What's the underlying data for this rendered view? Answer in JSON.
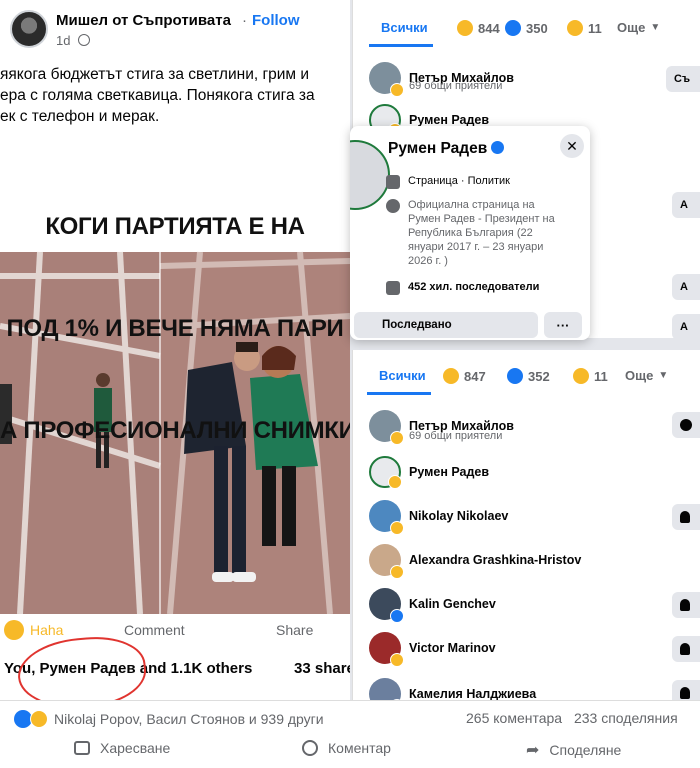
{
  "post": {
    "author": "Мишел от Съпротивата",
    "follow_label": "Follow",
    "separator": "·",
    "time": "1d",
    "text": "яякога бюджетът стига за светлини, грим и\nера с голяма светкавица. Понякога стига за\nек с телефон и мерак.",
    "meme_caption_lines": [
      "КОГИ ПАРТИЯТА Е НА",
      "ПОД 1% И ВЕЧЕ НЯМА ПАРИ",
      "А ПРОФЕСИОНАЛНИ СНИМКИ"
    ],
    "reaction_label": "Haha",
    "comment_label": "Comment",
    "share_label": "Share",
    "summary": "You, Румен Радев and 1.1K others",
    "shares": "33 share"
  },
  "panel_top": {
    "tab_all": "Всички",
    "haha_count": "844",
    "like_count": "350",
    "wow_count": "11",
    "more_label": "Още",
    "people": [
      {
        "name": "Петър Михайлов",
        "sub": "69 общи приятели",
        "button": "Съ"
      },
      {
        "name": "Румен Радев"
      }
    ],
    "side_buttons": [
      "А",
      "А",
      "А"
    ]
  },
  "hovercard": {
    "name": "Румен Радев",
    "type": "Страница · Политик",
    "description": "Официална страница на\nРумен Радев - Президент на\nРепублика България (22\nянуари 2017 г. – 23 януари\n2026 г. )",
    "followers": "452 хил. последователи",
    "following_label": "Последвано",
    "more_label": "···",
    "close_label": "✕"
  },
  "panel_bottom": {
    "tab_all": "Всички",
    "haha_count": "847",
    "like_count": "352",
    "wow_count": "11",
    "more_label": "Още",
    "people": [
      {
        "name": "Петър Михайлов",
        "sub": "69 общи приятели"
      },
      {
        "name": "Румен Радев"
      },
      {
        "name": "Nikolay Nikolaev"
      },
      {
        "name": "Alexandra Grashkina-Hristov"
      },
      {
        "name": "Kalin Genchev"
      },
      {
        "name": "Victor Marinov"
      },
      {
        "name": "Камелия Налджиева"
      }
    ]
  },
  "bottom": {
    "reactors": "Nikolaj Popov, Васил Стоянов и 939 други",
    "comments": "265 коментара",
    "shares": "233 споделяния",
    "like_label": "Харесване",
    "comment_label": "Коментар",
    "share_label": "Споделяне"
  },
  "colors": {
    "accent": "#1877f2",
    "haha": "#f7b928",
    "circle": "#e0342f"
  }
}
